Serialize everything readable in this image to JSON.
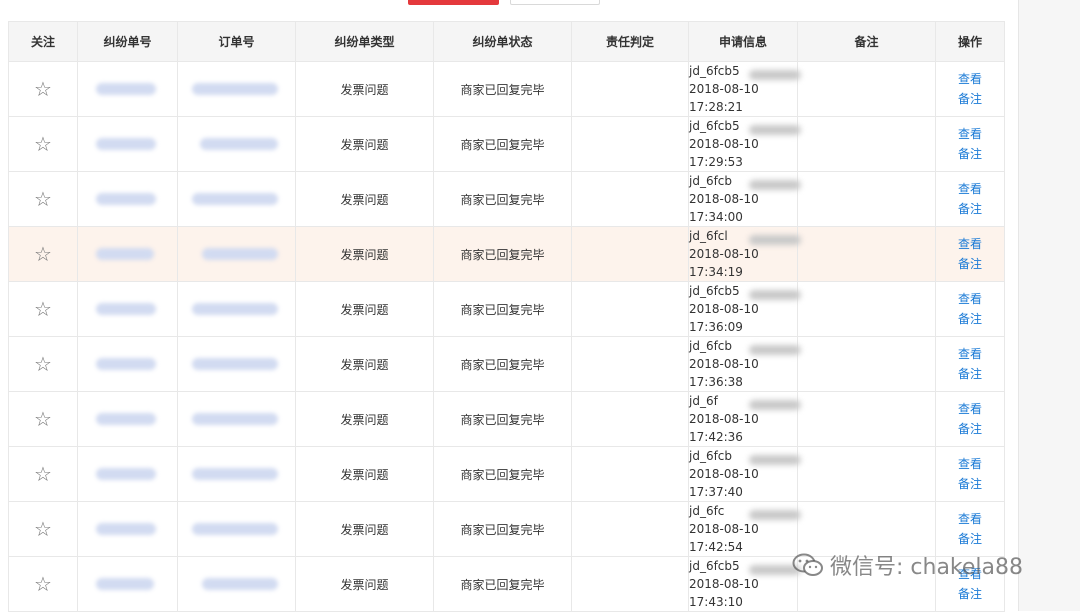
{
  "headers": [
    "关注",
    "纠纷单号",
    "订单号",
    "纠纷单类型",
    "纠纷单状态",
    "责任判定",
    "申请信息",
    "备注",
    "操作"
  ],
  "ops": {
    "view": "查看",
    "remark": "备注"
  },
  "star_glyph": "☆",
  "rows": [
    {
      "type": "发票问题",
      "status": "商家已回复完毕",
      "responsibility": "",
      "applicant": "jd_6fcb5",
      "date": "2018-08-10",
      "time": "17:28:21",
      "note": ""
    },
    {
      "type": "发票问题",
      "status": "商家已回复完毕",
      "responsibility": "",
      "applicant": "jd_6fcb5",
      "date": "2018-08-10",
      "time": "17:29:53",
      "note": ""
    },
    {
      "type": "发票问题",
      "status": "商家已回复完毕",
      "responsibility": "",
      "applicant": "jd_6fcb",
      "date": "2018-08-10",
      "time": "17:34:00",
      "note": ""
    },
    {
      "type": "发票问题",
      "status": "商家已回复完毕",
      "responsibility": "",
      "applicant": "jd_6fcl",
      "date": "2018-08-10",
      "time": "17:34:19",
      "note": "",
      "highlight": true
    },
    {
      "type": "发票问题",
      "status": "商家已回复完毕",
      "responsibility": "",
      "applicant": "jd_6fcb5",
      "date": "2018-08-10",
      "time": "17:36:09",
      "note": ""
    },
    {
      "type": "发票问题",
      "status": "商家已回复完毕",
      "responsibility": "",
      "applicant": "jd_6fcb",
      "date": "2018-08-10",
      "time": "17:36:38",
      "note": ""
    },
    {
      "type": "发票问题",
      "status": "商家已回复完毕",
      "responsibility": "",
      "applicant": "jd_6f",
      "date": "2018-08-10",
      "time": "17:42:36",
      "note": ""
    },
    {
      "type": "发票问题",
      "status": "商家已回复完毕",
      "responsibility": "",
      "applicant": "jd_6fcb",
      "date": "2018-08-10",
      "time": "17:37:40",
      "note": ""
    },
    {
      "type": "发票问题",
      "status": "商家已回复完毕",
      "responsibility": "",
      "applicant": "jd_6fc",
      "date": "2018-08-10",
      "time": "17:42:54",
      "note": ""
    },
    {
      "type": "发票问题",
      "status": "商家已回复完毕",
      "responsibility": "",
      "applicant": "jd_6fcb5",
      "date": "2018-08-10",
      "time": "17:43:10",
      "note": ""
    }
  ],
  "watermark": "微信号: chakela88",
  "colors": {
    "link": "#1a7ad6",
    "highlight_row": "#fdf3ec",
    "header_bg": "#f5f5f5",
    "primary_button": "#e4393c"
  }
}
